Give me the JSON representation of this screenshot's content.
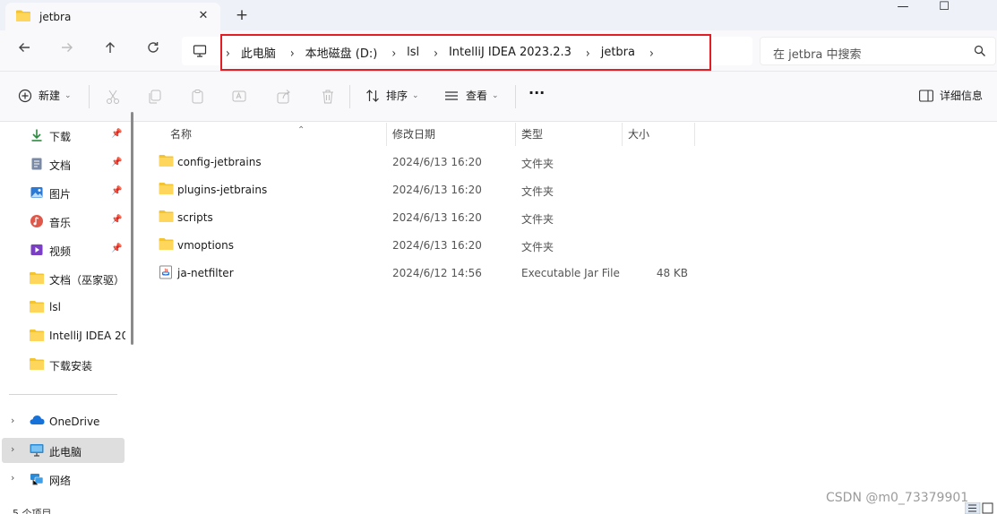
{
  "tab": {
    "title": "jetbra",
    "close": "✕",
    "new_tab": "+"
  },
  "window_controls": {
    "minimize": "—",
    "maximize": "☐"
  },
  "address": {
    "segments": [
      "此电脑",
      "本地磁盘 (D:)",
      "lsl",
      "IntelliJ IDEA 2023.2.3",
      "jetbra"
    ],
    "separator": "›"
  },
  "search": {
    "placeholder": "在 jetbra 中搜索"
  },
  "commands": {
    "new_label": "新建",
    "sort_label": "排序",
    "view_label": "查看",
    "more_label": "···",
    "details_label": "详细信息"
  },
  "sidebar": {
    "quick": [
      {
        "label": "下载",
        "icon": "download-icon",
        "pinned": true
      },
      {
        "label": "文档",
        "icon": "document-icon",
        "pinned": true
      },
      {
        "label": "图片",
        "icon": "picture-icon",
        "pinned": true
      },
      {
        "label": "音乐",
        "icon": "music-icon",
        "pinned": true
      },
      {
        "label": "视频",
        "icon": "video-icon",
        "pinned": true
      },
      {
        "label": "文档（巫家驱）",
        "icon": "folder-icon",
        "pinned": false
      },
      {
        "label": "lsl",
        "icon": "folder-icon",
        "pinned": false
      },
      {
        "label": "IntelliJ IDEA 20",
        "icon": "folder-icon",
        "pinned": false
      },
      {
        "label": "下载安装",
        "icon": "folder-icon",
        "pinned": false
      }
    ],
    "roots": [
      {
        "label": "OneDrive",
        "icon": "cloud-icon"
      },
      {
        "label": "此电脑",
        "icon": "pc-icon"
      },
      {
        "label": "网络",
        "icon": "network-icon"
      }
    ]
  },
  "columns": {
    "name": "名称",
    "modified": "修改日期",
    "type": "类型",
    "size": "大小"
  },
  "files": [
    {
      "name": "config-jetbrains",
      "modified": "2024/6/13 16:20",
      "type": "文件夹",
      "size": "",
      "icon": "folder-icon"
    },
    {
      "name": "plugins-jetbrains",
      "modified": "2024/6/13 16:20",
      "type": "文件夹",
      "size": "",
      "icon": "folder-icon"
    },
    {
      "name": "scripts",
      "modified": "2024/6/13 16:20",
      "type": "文件夹",
      "size": "",
      "icon": "folder-icon"
    },
    {
      "name": "vmoptions",
      "modified": "2024/6/13 16:20",
      "type": "文件夹",
      "size": "",
      "icon": "folder-icon"
    },
    {
      "name": "ja-netfilter",
      "modified": "2024/6/12 14:56",
      "type": "Executable Jar File",
      "size": "48 KB",
      "icon": "jar-icon"
    }
  ],
  "status": {
    "item_count": "5 个项目"
  },
  "watermark": "CSDN @m0_73379901",
  "colors": {
    "folder": "#f4c430",
    "highlight_border": "#e21e24",
    "selected_bg": "#dedede"
  }
}
